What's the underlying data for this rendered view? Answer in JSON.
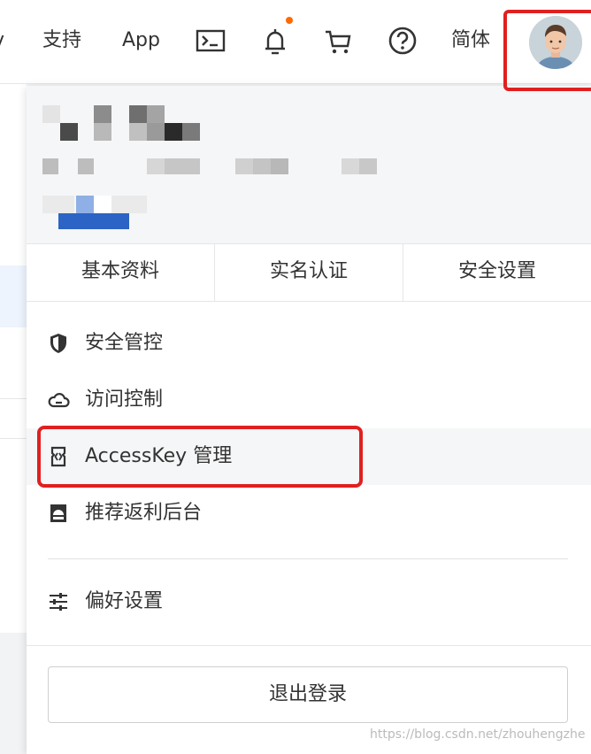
{
  "topnav": {
    "partial_item": "v",
    "support": "支持",
    "app": "App",
    "lang": "简体",
    "icons": [
      "terminal-icon",
      "bell-icon",
      "cart-icon",
      "help-icon",
      "avatar"
    ]
  },
  "dropdown": {
    "tabs": [
      "基本资料",
      "实名认证",
      "安全设置"
    ],
    "menu": [
      {
        "icon": "shield-icon",
        "label": "安全管控"
      },
      {
        "icon": "cloud-icon",
        "label": "访问控制"
      },
      {
        "icon": "key-doc-icon",
        "label": "AccessKey 管理"
      },
      {
        "icon": "rebate-icon",
        "label": "推荐返利后台"
      },
      {
        "icon": "sliders-icon",
        "label": "偏好设置"
      }
    ],
    "logout": "退出登录"
  },
  "watermark": "https://blog.csdn.net/zhouhengzhe",
  "colors": {
    "notify_dot": "#ff6a00",
    "highlight_red": "#e02020",
    "redacted_blue": "#2b64c4"
  }
}
